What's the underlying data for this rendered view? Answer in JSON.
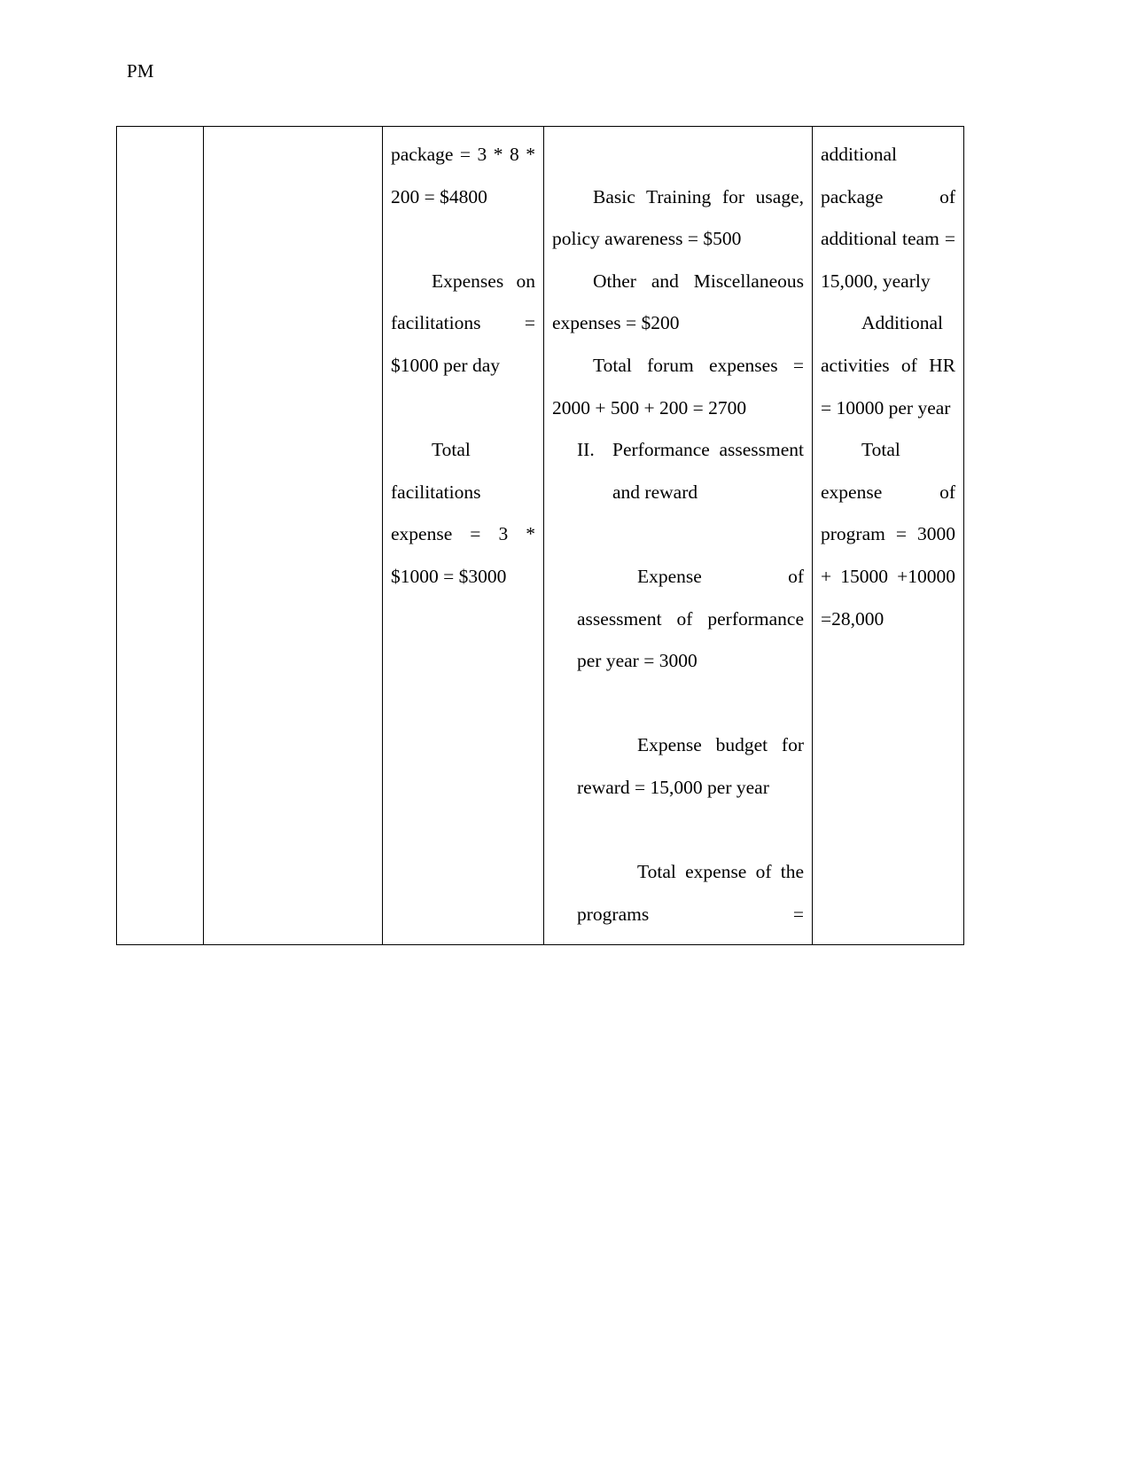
{
  "document": {
    "header": "PM",
    "page_background": "#ffffff",
    "text_color": "#000000",
    "table_border_color": "#000000"
  },
  "table": {
    "columns": [
      {
        "name": "col-1",
        "content": ""
      },
      {
        "name": "col-2",
        "content": ""
      },
      {
        "name": "col-3",
        "content": ""
      },
      {
        "name": "col-4",
        "content": ""
      },
      {
        "name": "col-5",
        "content": ""
      }
    ],
    "row": {
      "col3_paragraphs": [
        "package = 3 * 8 * 200 = $4800",
        "Expenses on facilitations = $1000 per day",
        "Total facilitations expense = 3 * $1000 = $3000"
      ],
      "col4_paragraphs": [
        "Basic Training for usage, policy awareness = $500",
        "Other and Miscellaneous expenses = $200",
        "Total forum expenses = 2000 + 500 + 200 = 2700"
      ],
      "col4_list": {
        "number": "II.",
        "text": "Performance assessment and reward"
      },
      "col4_after_list": [
        "Expense of assessment of performance per year = 3000",
        "Expense budget for reward = 15,000 per year",
        "Total expense of the programs ="
      ],
      "col5_paragraphs": [
        "additional package of additional team = 15,000, yearly",
        "Additional activities of HR = 10000 per year",
        "Total expense of program = 3000 + 15000 +10000 =28,000"
      ]
    }
  }
}
